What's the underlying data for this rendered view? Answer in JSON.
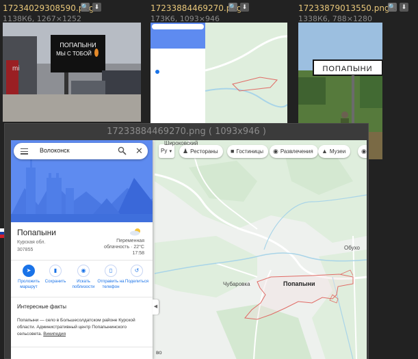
{
  "thumbnails": [
    {
      "filename": "17234029308590.png",
      "meta": "1138К6, 1267×1252",
      "billboard_text": "ПОПАПЫНИ МЫ С ТОБОЙ"
    },
    {
      "filename": "17233884469270.png",
      "meta": "173К6, 1093×946"
    },
    {
      "filename": "17233879013550.png",
      "meta": "1338К6, 788×1280",
      "sign_text": "ПОПАПЫНИ"
    }
  ],
  "viewer": {
    "title": "17233884469270.png ( 1093x946 )"
  },
  "maps_panel": {
    "search_query": "Волоконск",
    "place_name": "Попапыни",
    "region": "Курская обл.",
    "postal_code": "307855",
    "weather_text": "Переменная облачность · 22°C",
    "weather_time": "17:58",
    "actions": [
      {
        "icon": "directions-icon",
        "label": "Проложить маршрут"
      },
      {
        "icon": "bookmark-icon",
        "label": "Сохранить"
      },
      {
        "icon": "nearby-icon",
        "label": "Искать поблизости"
      },
      {
        "icon": "phone-icon",
        "label": "Отправить на телефон"
      },
      {
        "icon": "share-icon",
        "label": "Поделиться"
      }
    ],
    "facts_title": "Интересные факты",
    "facts_text": "Попапыни — село в Большесолдатском районе Курской области. Административный центр Попапынинского сельсовета.",
    "facts_link": "Википедия"
  },
  "map": {
    "language": "Ру",
    "chips": [
      {
        "icon": "fork-knife-icon",
        "label": "Рестораны"
      },
      {
        "icon": "bed-icon",
        "label": "Гостиницы"
      },
      {
        "icon": "camera-icon",
        "label": "Развлечения"
      },
      {
        "icon": "museum-icon",
        "label": "Музеи"
      }
    ],
    "labels": {
      "top_left": "Широковский",
      "right": "Обухо",
      "village_a": "Чубаровка",
      "village_b": "Попапыни",
      "bottom": "во"
    }
  },
  "colors": {
    "background": "#222222",
    "filename": "#e8c77a",
    "map_green": "#dfeedd",
    "map_road": "#ffffff",
    "water": "#a8d4e8",
    "boundary": "#e06a64",
    "panel_blue": "#5e8bf0",
    "accent_blue": "#1a73e8"
  }
}
